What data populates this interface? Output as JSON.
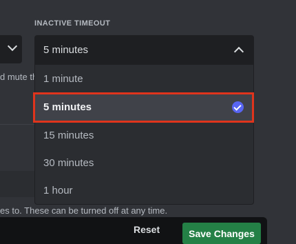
{
  "background_partial": {
    "mute_text": "d mute th",
    "helper_text": "es to. These can be turned off at any time."
  },
  "inactive_timeout": {
    "label": "INACTIVE TIMEOUT",
    "selected_value": "5 minutes",
    "options": [
      {
        "label": "1 minute",
        "selected": false
      },
      {
        "label": "5 minutes",
        "selected": true
      },
      {
        "label": "15 minutes",
        "selected": false
      },
      {
        "label": "30 minutes",
        "selected": false
      },
      {
        "label": "1 hour",
        "selected": false
      }
    ]
  },
  "footer": {
    "reset_label": "Reset",
    "save_label": "Save Changes"
  },
  "colors": {
    "accent": "#5865f2",
    "save_green": "#248046",
    "highlight_red": "#e0341c"
  }
}
